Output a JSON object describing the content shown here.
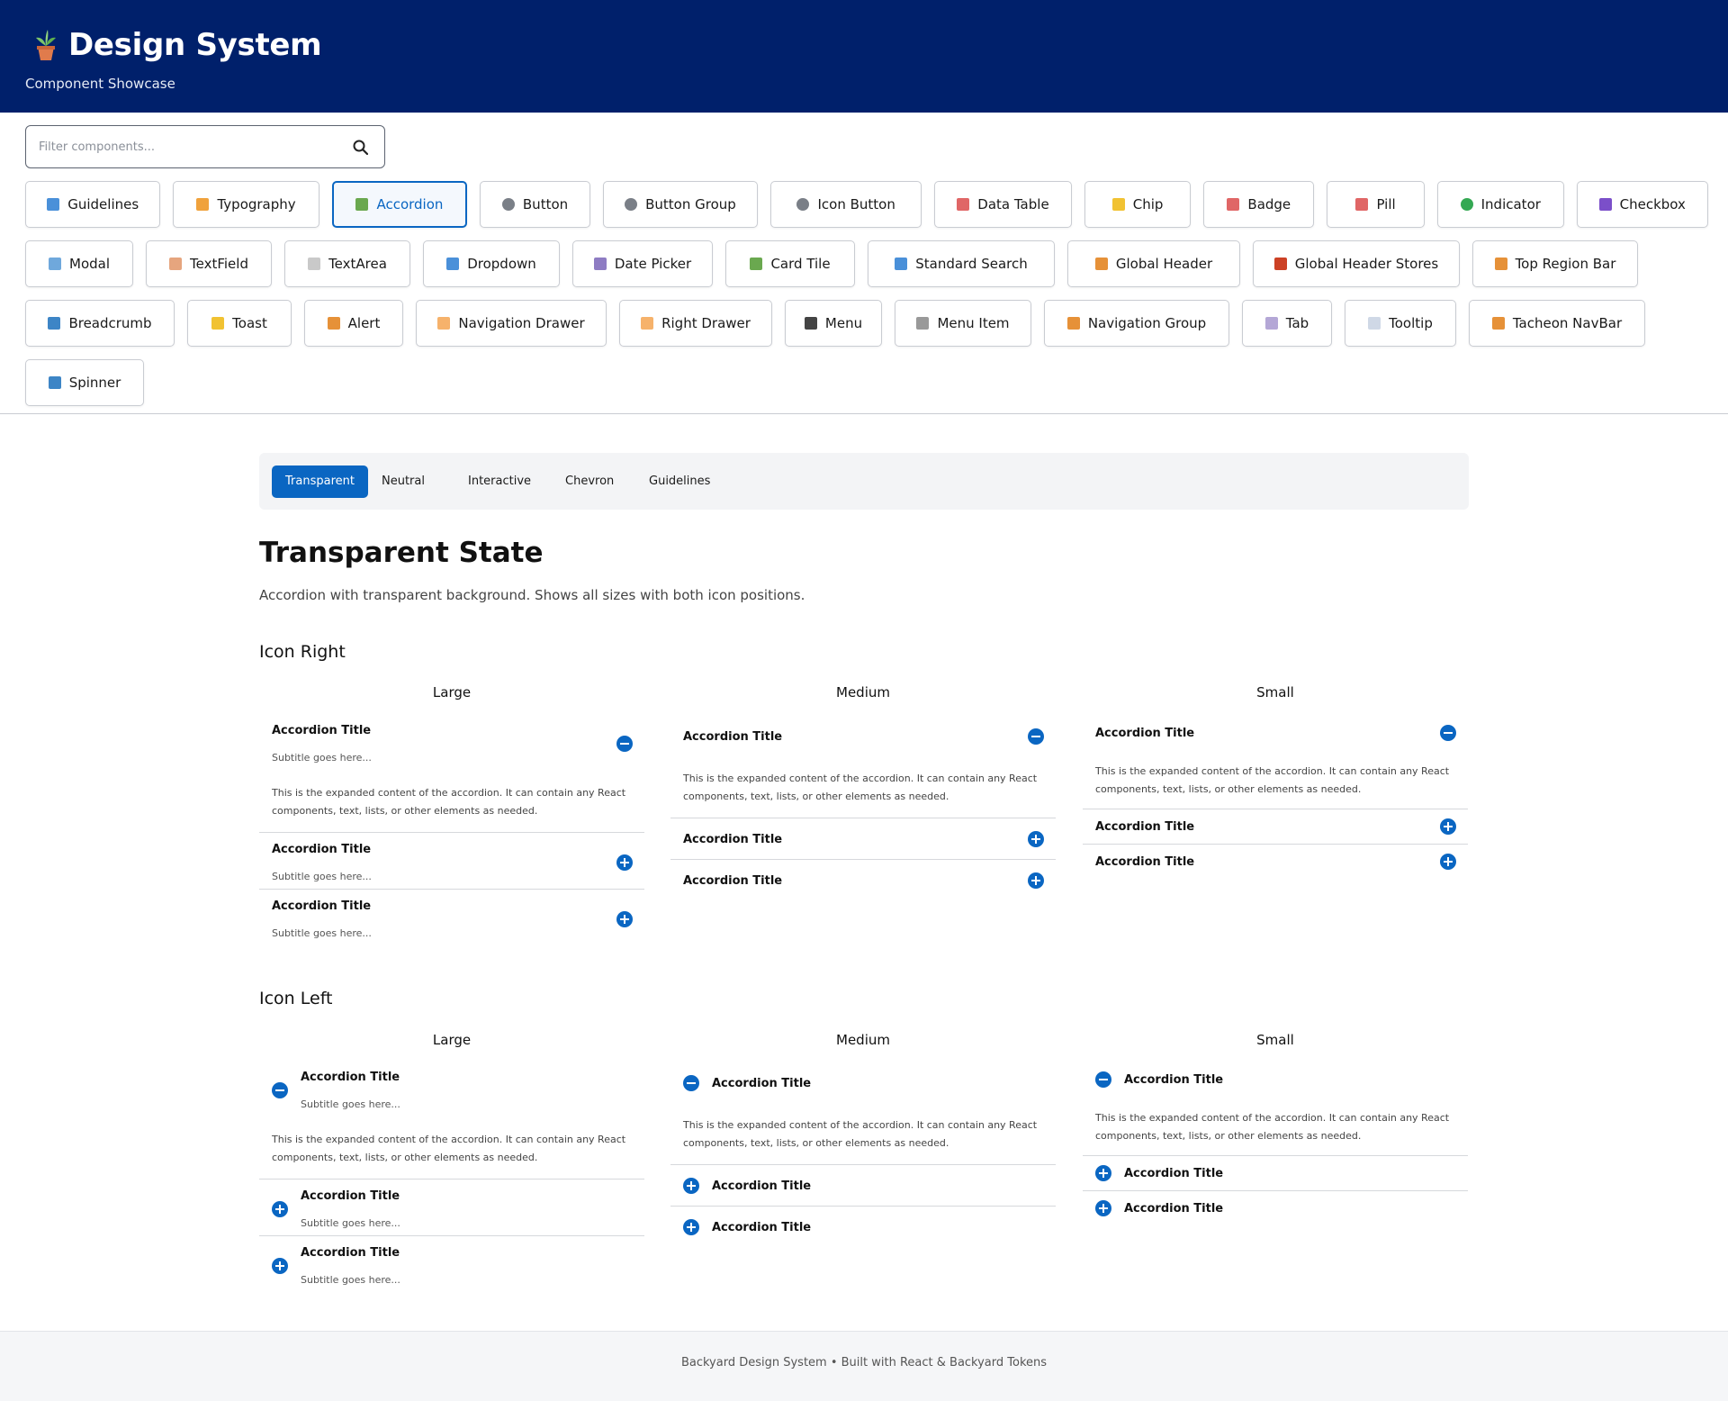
{
  "header": {
    "title": "Design System",
    "subtitle": "Component Showcase"
  },
  "filter": {
    "placeholder": "Filter components..."
  },
  "components": [
    [
      {
        "label": "Guidelines",
        "icon": "book-icon",
        "color": "#4a90d9"
      },
      {
        "label": "Typography",
        "icon": "writing-hand-icon",
        "color": "#f0a23c"
      },
      {
        "label": "Accordion",
        "icon": "books-icon",
        "color": "#6aa84f",
        "active": true
      },
      {
        "label": "Button",
        "icon": "circle-icon",
        "color": "#7a7f87"
      },
      {
        "label": "Button Group",
        "icon": "circle-icon",
        "color": "#7a7f87"
      },
      {
        "label": "Icon Button",
        "icon": "circle-icon",
        "color": "#7a7f87"
      },
      {
        "label": "Data Table",
        "icon": "bar-chart-icon",
        "color": "#e06666"
      },
      {
        "label": "Chip",
        "icon": "tag-icon",
        "color": "#f1c232"
      },
      {
        "label": "Badge",
        "icon": "badge-icon",
        "color": "#e06666"
      },
      {
        "label": "Pill",
        "icon": "pill-icon",
        "color": "#e06666"
      },
      {
        "label": "Indicator",
        "icon": "green-dot-icon",
        "color": "#34a853"
      },
      {
        "label": "Checkbox",
        "icon": "checkbox-icon",
        "color": "#7b4fc9"
      }
    ],
    [
      {
        "label": "Modal",
        "icon": "window-icon",
        "color": "#6fa8dc"
      },
      {
        "label": "TextField",
        "icon": "memo-icon",
        "color": "#e6a57e"
      },
      {
        "label": "TextArea",
        "icon": "document-icon",
        "color": "#c9c9c9"
      },
      {
        "label": "Dropdown",
        "icon": "dropdown-icon",
        "color": "#4a90d9"
      },
      {
        "label": "Date Picker",
        "icon": "calendar-icon",
        "color": "#8e7cc3"
      },
      {
        "label": "Card Tile",
        "icon": "puzzle-icon",
        "color": "#6aa84f"
      },
      {
        "label": "Standard Search",
        "icon": "magnifier-icon",
        "color": "#4a90d9"
      },
      {
        "label": "Global Header",
        "icon": "compass-icon",
        "color": "#e69138"
      },
      {
        "label": "Global Header Stores",
        "icon": "store-icon",
        "color": "#cc4125"
      },
      {
        "label": "Top Region Bar",
        "icon": "compass-icon",
        "color": "#e69138"
      }
    ],
    [
      {
        "label": "Breadcrumb",
        "icon": "map-icon",
        "color": "#3d85c6"
      },
      {
        "label": "Toast",
        "icon": "bell-icon",
        "color": "#f1c232"
      },
      {
        "label": "Alert",
        "icon": "warning-icon",
        "color": "#e69138"
      },
      {
        "label": "Navigation Drawer",
        "icon": "folder-icon",
        "color": "#f6b26b"
      },
      {
        "label": "Right Drawer",
        "icon": "folder-icon",
        "color": "#f6b26b"
      },
      {
        "label": "Menu",
        "icon": "menu-icon",
        "color": "#444444"
      },
      {
        "label": "Menu Item",
        "icon": "list-icon",
        "color": "#999999"
      },
      {
        "label": "Navigation Group",
        "icon": "compass-icon",
        "color": "#e69138"
      },
      {
        "label": "Tab",
        "icon": "tab-icon",
        "color": "#b4a7d6"
      },
      {
        "label": "Tooltip",
        "icon": "speech-bubble-icon",
        "color": "#cfd8e6"
      },
      {
        "label": "Tacheon NavBar",
        "icon": "compass-icon",
        "color": "#e69138"
      }
    ],
    [
      {
        "label": "Spinner",
        "icon": "refresh-icon",
        "color": "#3d85c6"
      }
    ]
  ],
  "tabs": [
    "Transparent",
    "Neutral",
    "Interactive",
    "Chevron",
    "Guidelines"
  ],
  "page": {
    "title": "Transparent State",
    "description": "Accordion with transparent background. Shows all sizes with both icon positions.",
    "icon_right": "Icon Right",
    "icon_left": "Icon Left",
    "sizes": [
      "Large",
      "Medium",
      "Small"
    ]
  },
  "accordion": {
    "title": "Accordion Title",
    "subtitle": "Subtitle goes here...",
    "body": "This is the expanded content of the accordion. It can contain any React components, text, lists, or other elements as needed."
  },
  "footer": {
    "text": "Backyard Design System • Built with React & Backyard Tokens"
  },
  "colors": {
    "header_bg": "#00206b",
    "accent": "#0a66c2"
  }
}
